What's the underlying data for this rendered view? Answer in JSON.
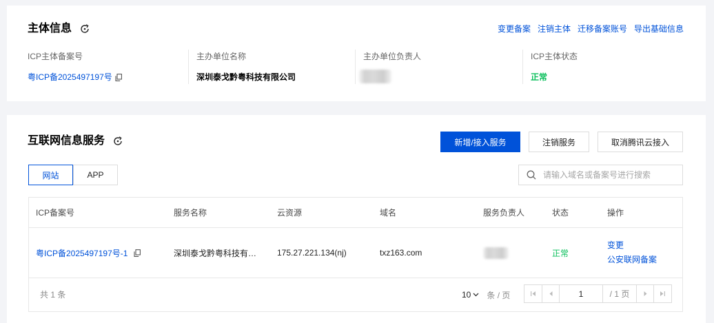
{
  "subject_info": {
    "title": "主体信息",
    "title_icon": "refresh-icon",
    "actions": [
      "变更备案",
      "注销主体",
      "迁移备案账号",
      "导出基础信息"
    ],
    "fields": [
      {
        "label": "ICP主体备案号",
        "value": "粤ICP备2025497197号"
      },
      {
        "label": "主办单位名称",
        "value": "深圳泰戈黔粤科技有限公司"
      },
      {
        "label": "主办单位负责人"
      },
      {
        "label": "ICP主体状态",
        "value": "正常"
      }
    ]
  },
  "services": {
    "title": "互联网信息服务",
    "title_icon": "refresh-icon",
    "buttons": {
      "add": "新增/接入服务",
      "deregister": "注销服务",
      "cancel_access": "取消腾讯云接入"
    },
    "tabs": [
      {
        "label": "网站",
        "active": true
      },
      {
        "label": "APP",
        "active": false
      }
    ],
    "search": {
      "placeholder": "请输入域名或备案号进行搜索",
      "icon": "search-icon"
    },
    "table": {
      "columns": [
        "ICP备案号",
        "服务名称",
        "云资源",
        "域名",
        "服务负责人",
        "状态",
        "操作"
      ],
      "rows": [
        {
          "icp_number": "粤ICP备2025497197号-1",
          "service_name": "深圳泰戈黔粤科技有…",
          "cloud_resource": "175.27.221.134(nj)",
          "domain": "txz163.com",
          "status": "正常",
          "actions": [
            "变更",
            "公安联网备案"
          ]
        }
      ]
    },
    "pagination": {
      "total": "共 1 条",
      "page_size": "10",
      "page_size_unit": "条 / 页",
      "current_page": "1",
      "total_pages": "/ 1 页"
    }
  },
  "colors": {
    "brand": "#0052d9",
    "success": "#0abf5b",
    "background": "#f3f4f7"
  }
}
